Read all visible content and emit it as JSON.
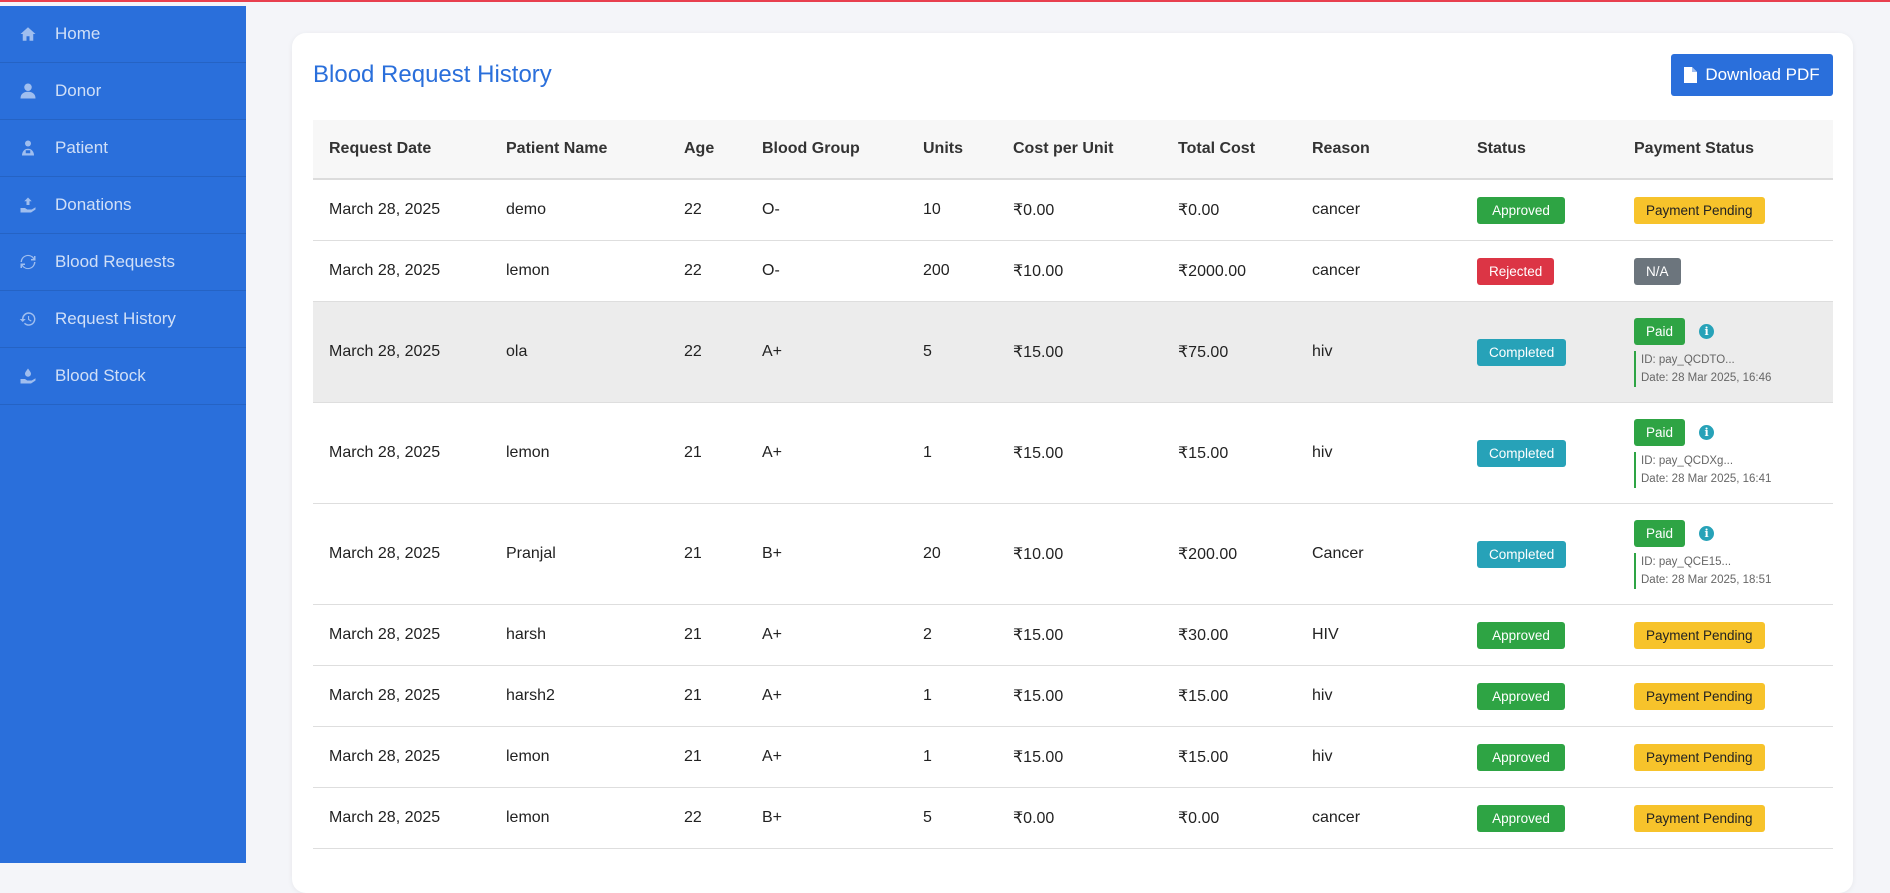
{
  "sidebar": {
    "items": [
      {
        "label": "Home",
        "icon": "home-icon"
      },
      {
        "label": "Donor",
        "icon": "user-icon"
      },
      {
        "label": "Patient",
        "icon": "patient-icon"
      },
      {
        "label": "Donations",
        "icon": "donate-icon"
      },
      {
        "label": "Blood Requests",
        "icon": "sync-icon"
      },
      {
        "label": "Request History",
        "icon": "history-icon"
      },
      {
        "label": "Blood Stock",
        "icon": "hand-holding-icon"
      }
    ]
  },
  "page": {
    "title": "Blood Request History",
    "download_label": "Download PDF"
  },
  "table": {
    "headers": [
      "Request Date",
      "Patient Name",
      "Age",
      "Blood Group",
      "Units",
      "Cost per Unit",
      "Total Cost",
      "Reason",
      "Status",
      "Payment Status"
    ],
    "rows": [
      {
        "date": "March 28, 2025",
        "name": "demo",
        "age": "22",
        "group": "O-",
        "units": "10",
        "cpu": "₹0.00",
        "total": "₹0.00",
        "reason": "cancer",
        "status": "Approved",
        "payment": "Payment Pending"
      },
      {
        "date": "March 28, 2025",
        "name": "lemon",
        "age": "22",
        "group": "O-",
        "units": "200",
        "cpu": "₹10.00",
        "total": "₹2000.00",
        "reason": "cancer",
        "status": "Rejected",
        "payment": "N/A"
      },
      {
        "date": "March 28, 2025",
        "name": "ola",
        "age": "22",
        "group": "A+",
        "units": "5",
        "cpu": "₹15.00",
        "total": "₹75.00",
        "reason": "hiv",
        "status": "Completed",
        "payment": "Paid",
        "pay_id": "ID: pay_QCDTO...",
        "pay_date": "Date: 28 Mar 2025, 16:46"
      },
      {
        "date": "March 28, 2025",
        "name": "lemon",
        "age": "21",
        "group": "A+",
        "units": "1",
        "cpu": "₹15.00",
        "total": "₹15.00",
        "reason": "hiv",
        "status": "Completed",
        "payment": "Paid",
        "pay_id": "ID: pay_QCDXg...",
        "pay_date": "Date: 28 Mar 2025, 16:41"
      },
      {
        "date": "March 28, 2025",
        "name": "Pranjal",
        "age": "21",
        "group": "B+",
        "units": "20",
        "cpu": "₹10.00",
        "total": "₹200.00",
        "reason": "Cancer",
        "status": "Completed",
        "payment": "Paid",
        "pay_id": "ID: pay_QCE15...",
        "pay_date": "Date: 28 Mar 2025, 18:51"
      },
      {
        "date": "March 28, 2025",
        "name": "harsh",
        "age": "21",
        "group": "A+",
        "units": "2",
        "cpu": "₹15.00",
        "total": "₹30.00",
        "reason": "HIV",
        "status": "Approved",
        "payment": "Payment Pending"
      },
      {
        "date": "March 28, 2025",
        "name": "harsh2",
        "age": "21",
        "group": "A+",
        "units": "1",
        "cpu": "₹15.00",
        "total": "₹15.00",
        "reason": "hiv",
        "status": "Approved",
        "payment": "Payment Pending"
      },
      {
        "date": "March 28, 2025",
        "name": "lemon",
        "age": "21",
        "group": "A+",
        "units": "1",
        "cpu": "₹15.00",
        "total": "₹15.00",
        "reason": "hiv",
        "status": "Approved",
        "payment": "Payment Pending"
      },
      {
        "date": "March 28, 2025",
        "name": "lemon",
        "age": "22",
        "group": "B+",
        "units": "5",
        "cpu": "₹0.00",
        "total": "₹0.00",
        "reason": "cancer",
        "status": "Approved",
        "payment": "Payment Pending"
      }
    ]
  },
  "colors": {
    "sidebar": "#2a6fdb",
    "approved": "#2ea444",
    "rejected": "#dc3545",
    "completed": "#27a2b8",
    "pending": "#f7c32b",
    "na": "#6c757d"
  }
}
